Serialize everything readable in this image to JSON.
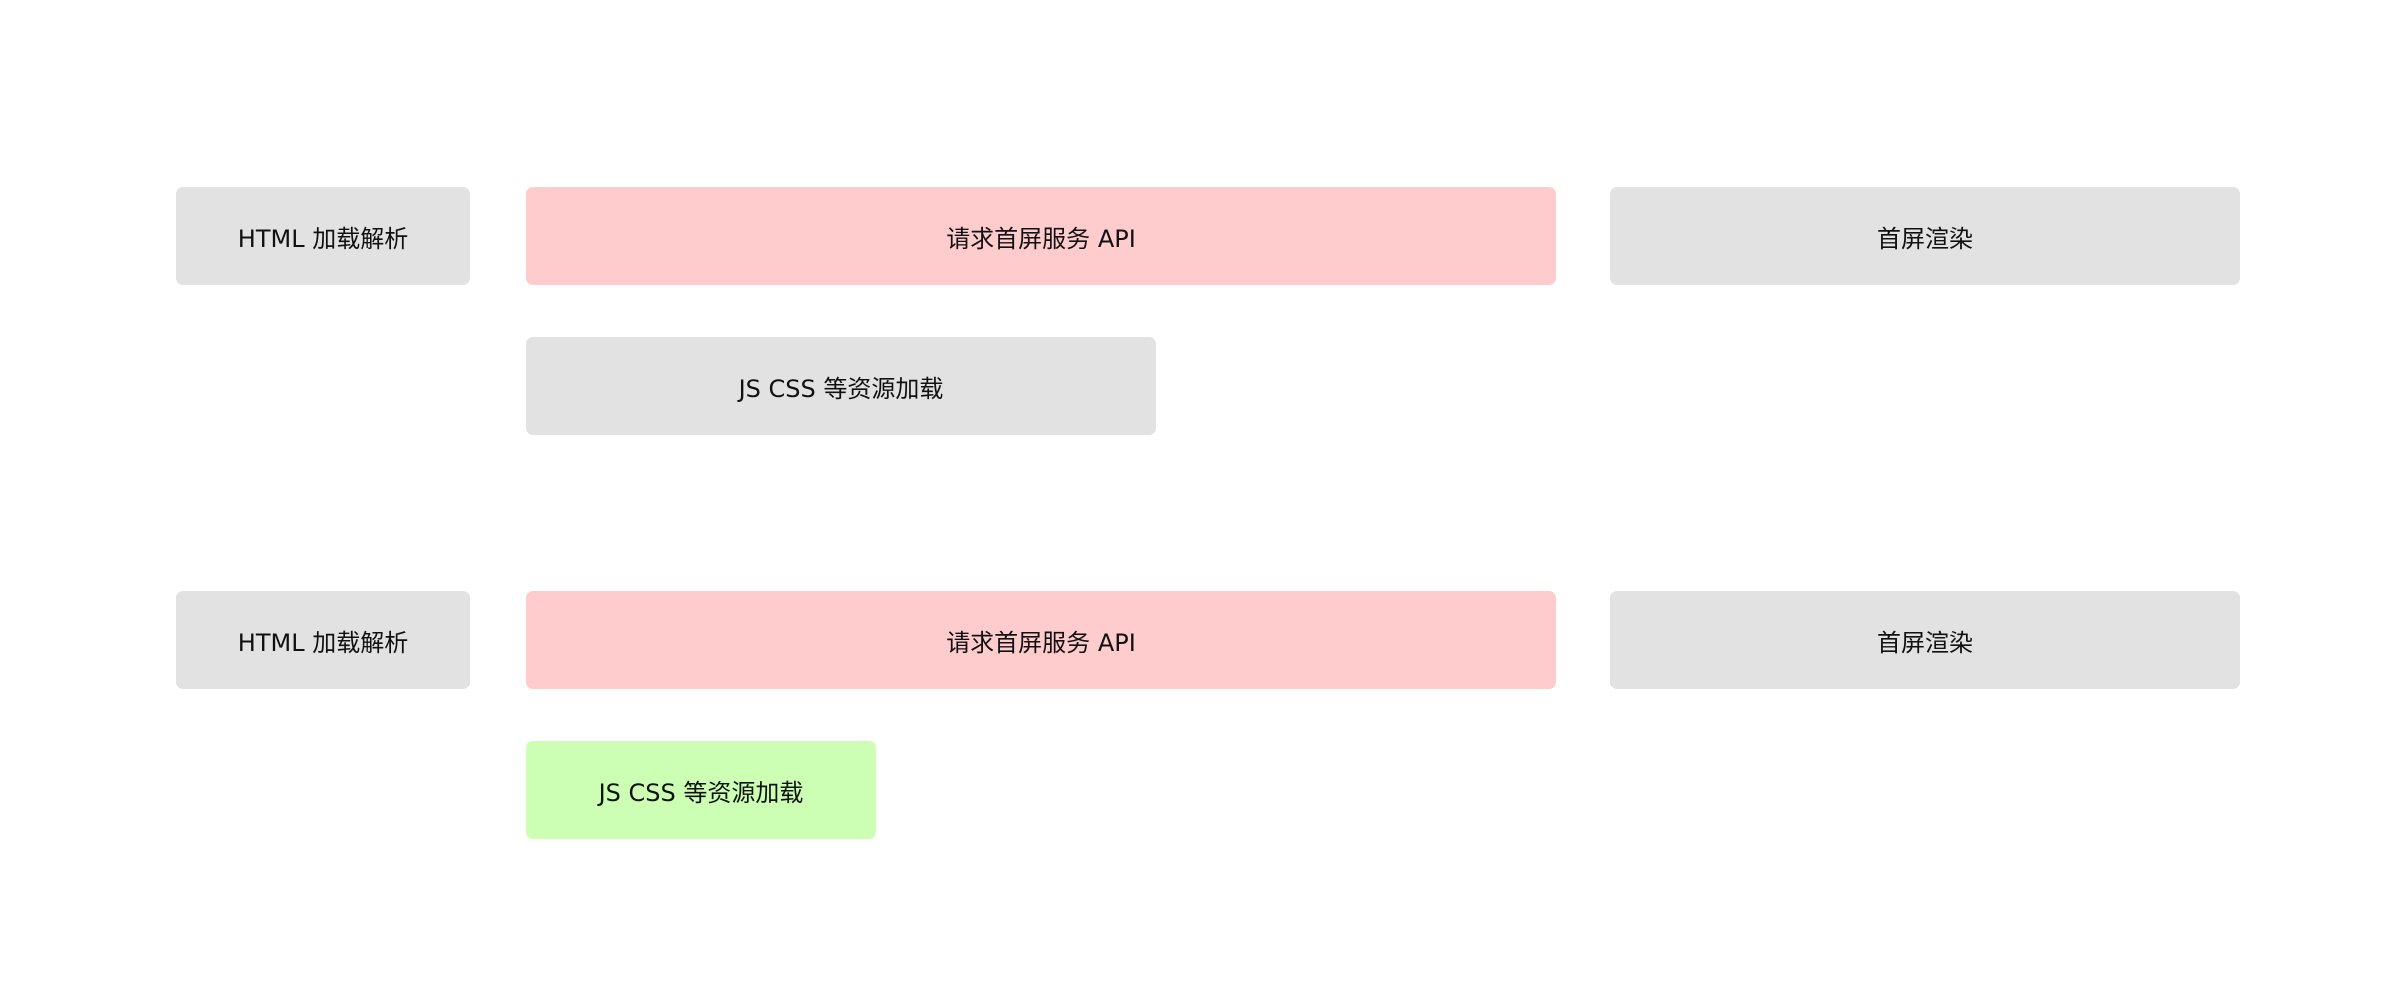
{
  "colors": {
    "neutral": "#e2e2e2",
    "api_highlight": "#ffcccd",
    "optimized_highlight": "#ccffb3",
    "text": "#111111"
  },
  "scenarios": [
    {
      "html_label": "HTML 加载解析",
      "api_label": "请求首屏服务 API",
      "render_label": "首屏渲染",
      "resources_label": "JS CSS 等资源加载"
    },
    {
      "html_label": "HTML 加载解析",
      "api_label": "请求首屏服务 API",
      "render_label": "首屏渲染",
      "resources_label": "JS CSS 等资源加载"
    }
  ]
}
